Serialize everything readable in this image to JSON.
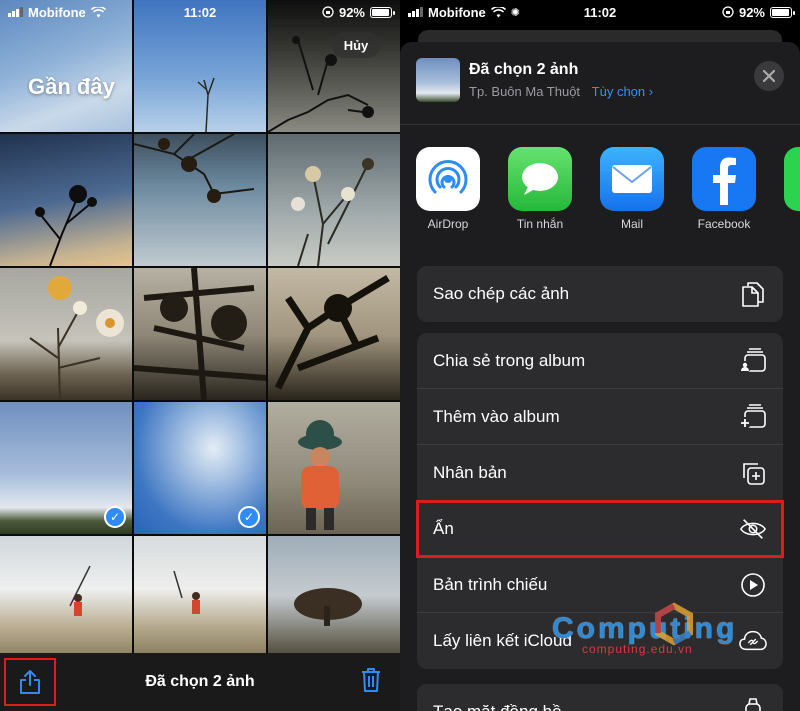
{
  "left_screen": {
    "status": {
      "carrier": "Mobifone",
      "time": "11:02",
      "battery": "92%",
      "battery_level": 0.92
    },
    "album_title": "Gần đây",
    "cancel_label": "Hủy",
    "toolbar_title": "Đã chọn 2 ảnh",
    "selected_count": 2
  },
  "right_screen": {
    "status": {
      "carrier": "Mobifone",
      "time": "11:02",
      "battery": "92%",
      "battery_level": 0.92
    },
    "sheet": {
      "title": "Đã chọn 2 ảnh",
      "location": "Tp. Buôn Ma Thuột",
      "options_label": "Tùy chọn",
      "options_icon": "chevron-right-icon"
    },
    "apps": [
      {
        "label": "AirDrop",
        "icon": "airdrop-icon",
        "color": "#ffffff"
      },
      {
        "label": "Tin nhắn",
        "icon": "messages-icon",
        "color": "#34c759"
      },
      {
        "label": "Mail",
        "icon": "mail-icon",
        "color": "#1e8ff5"
      },
      {
        "label": "Facebook",
        "icon": "facebook-icon",
        "color": "#1877f2"
      }
    ],
    "actions_group1": [
      {
        "label": "Sao chép các ảnh",
        "icon": "copy-icon"
      }
    ],
    "actions_group2": [
      {
        "label": "Chia sẻ trong album",
        "icon": "shared-album-icon"
      },
      {
        "label": "Thêm vào album",
        "icon": "add-to-album-icon"
      },
      {
        "label": "Nhân bản",
        "icon": "duplicate-icon"
      },
      {
        "label": "Ẩn",
        "icon": "hide-icon"
      },
      {
        "label": "Bản trình chiếu",
        "icon": "slideshow-icon"
      },
      {
        "label": "Lấy liên kết iCloud",
        "icon": "icloud-link-icon"
      }
    ],
    "actions_group3": [
      {
        "label": "Tạo mặt đồng hồ",
        "icon": "watch-icon"
      }
    ]
  },
  "watermark": {
    "brand": "Computing",
    "site": "computing.edu.vn"
  },
  "colors": {
    "accent": "#2f8cf6",
    "highlight": "#e01b1b",
    "sheet_bg": "#1d1d1f",
    "row_bg": "#2c2c2e"
  }
}
